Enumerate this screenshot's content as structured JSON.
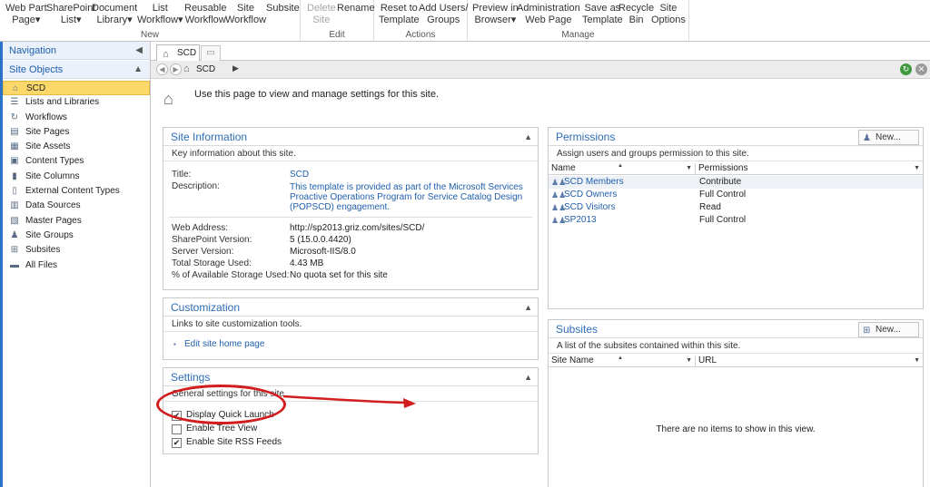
{
  "ribbon": {
    "new_group": "New",
    "edit_group": "Edit",
    "actions_group": "Actions",
    "manage_group": "Manage",
    "new_buttons": [
      {
        "line1": "Web Part",
        "line2": "Page▾"
      },
      {
        "line1": "SharePoint",
        "line2": "List▾"
      },
      {
        "line1": "Document",
        "line2": "Library▾"
      },
      {
        "line1": "List",
        "line2": "Workflow▾"
      },
      {
        "line1": "Reusable",
        "line2": "Workflow"
      },
      {
        "line1": "Site",
        "line2": "Workflow"
      },
      {
        "line1": "Subsite",
        "line2": ""
      }
    ],
    "edit_buttons": [
      {
        "line1": "Delete",
        "line2": "Site"
      },
      {
        "line1": "Rename",
        "line2": ""
      }
    ],
    "actions_buttons": [
      {
        "line1": "Reset to",
        "line2": "Template"
      },
      {
        "line1": "Add Users/",
        "line2": "Groups"
      }
    ],
    "manage_buttons": [
      {
        "line1": "Preview in",
        "line2": "Browser▾"
      },
      {
        "line1": "Administration",
        "line2": "Web Page"
      },
      {
        "line1": "Save as",
        "line2": "Template"
      },
      {
        "line1": "Recycle",
        "line2": "Bin"
      },
      {
        "line1": "Site",
        "line2": "Options"
      }
    ]
  },
  "nav": {
    "header": "Navigation",
    "section": "Site Objects",
    "items": [
      {
        "label": "SCD",
        "icon": "home-icon",
        "glyph": "⌂"
      },
      {
        "label": "Lists and Libraries",
        "icon": "list-icon",
        "glyph": "☰"
      },
      {
        "label": "Workflows",
        "icon": "workflow-icon",
        "glyph": "↻"
      },
      {
        "label": "Site Pages",
        "icon": "pages-icon",
        "glyph": "▤"
      },
      {
        "label": "Site Assets",
        "icon": "assets-icon",
        "glyph": "▦"
      },
      {
        "label": "Content Types",
        "icon": "content-types-icon",
        "glyph": "▣"
      },
      {
        "label": "Site Columns",
        "icon": "columns-icon",
        "glyph": "▮"
      },
      {
        "label": "External Content Types",
        "icon": "external-content-icon",
        "glyph": "▯"
      },
      {
        "label": "Data Sources",
        "icon": "database-icon",
        "glyph": "▥"
      },
      {
        "label": "Master Pages",
        "icon": "master-pages-icon",
        "glyph": "▧"
      },
      {
        "label": "Site Groups",
        "icon": "groups-icon",
        "glyph": "♟"
      },
      {
        "label": "Subsites",
        "icon": "subsites-icon",
        "glyph": "⊞"
      },
      {
        "label": "All Files",
        "icon": "folder-icon",
        "glyph": "▬"
      }
    ]
  },
  "tabs": {
    "active": "SCD"
  },
  "breadcrumb": {
    "site": "SCD"
  },
  "intro": "Use this page to view and manage settings for this site.",
  "site_info": {
    "title": "Site Information",
    "desc": "Key information about this site.",
    "title_label": "Title:",
    "title_value": "SCD",
    "description_label": "Description:",
    "description_l1": "This template is provided as part of the Microsoft Services",
    "description_l2": "Proactive Operations Program for Service Catalog Design",
    "description_l3": "(POPSCD) engagement.",
    "fields": [
      {
        "label": "Web Address:",
        "value": "http://sp2013.griz.com/sites/SCD/"
      },
      {
        "label": "SharePoint Version:",
        "value": "5 (15.0.0.4420)"
      },
      {
        "label": "Server Version:",
        "value": "Microsoft-IIS/8.0"
      },
      {
        "label": "Total Storage Used:",
        "value": "4.43 MB"
      },
      {
        "label": "% of Available Storage Used:",
        "value": "No quota set for this site"
      }
    ]
  },
  "customization": {
    "title": "Customization",
    "desc": "Links to site customization tools.",
    "link": "Edit site home page"
  },
  "settings": {
    "title": "Settings",
    "desc": "General settings for this site.",
    "options": [
      {
        "label": "Display Quick Launch",
        "checked": true
      },
      {
        "label": "Enable Tree View",
        "checked": false
      },
      {
        "label": "Enable Site RSS Feeds",
        "checked": true
      }
    ]
  },
  "permissions": {
    "title": "Permissions",
    "new_label": "New...",
    "desc": "Assign users and groups permission to this site.",
    "col_name": "Name",
    "col_perm": "Permissions",
    "rows": [
      {
        "name": "SCD Members",
        "perm": "Contribute"
      },
      {
        "name": "SCD Owners",
        "perm": "Full Control"
      },
      {
        "name": "SCD Visitors",
        "perm": "Read"
      },
      {
        "name": "SP2013",
        "perm": "Full Control"
      }
    ]
  },
  "subsites": {
    "title": "Subsites",
    "new_label": "New...",
    "desc": "A list of the subsites contained within this site.",
    "col_name": "Site Name",
    "col_url": "URL",
    "empty": "There are no items to show in this view."
  },
  "colors": {
    "accent": "#2d6cb7",
    "selected": "#fcd769",
    "annotation": "#d11d1d"
  }
}
